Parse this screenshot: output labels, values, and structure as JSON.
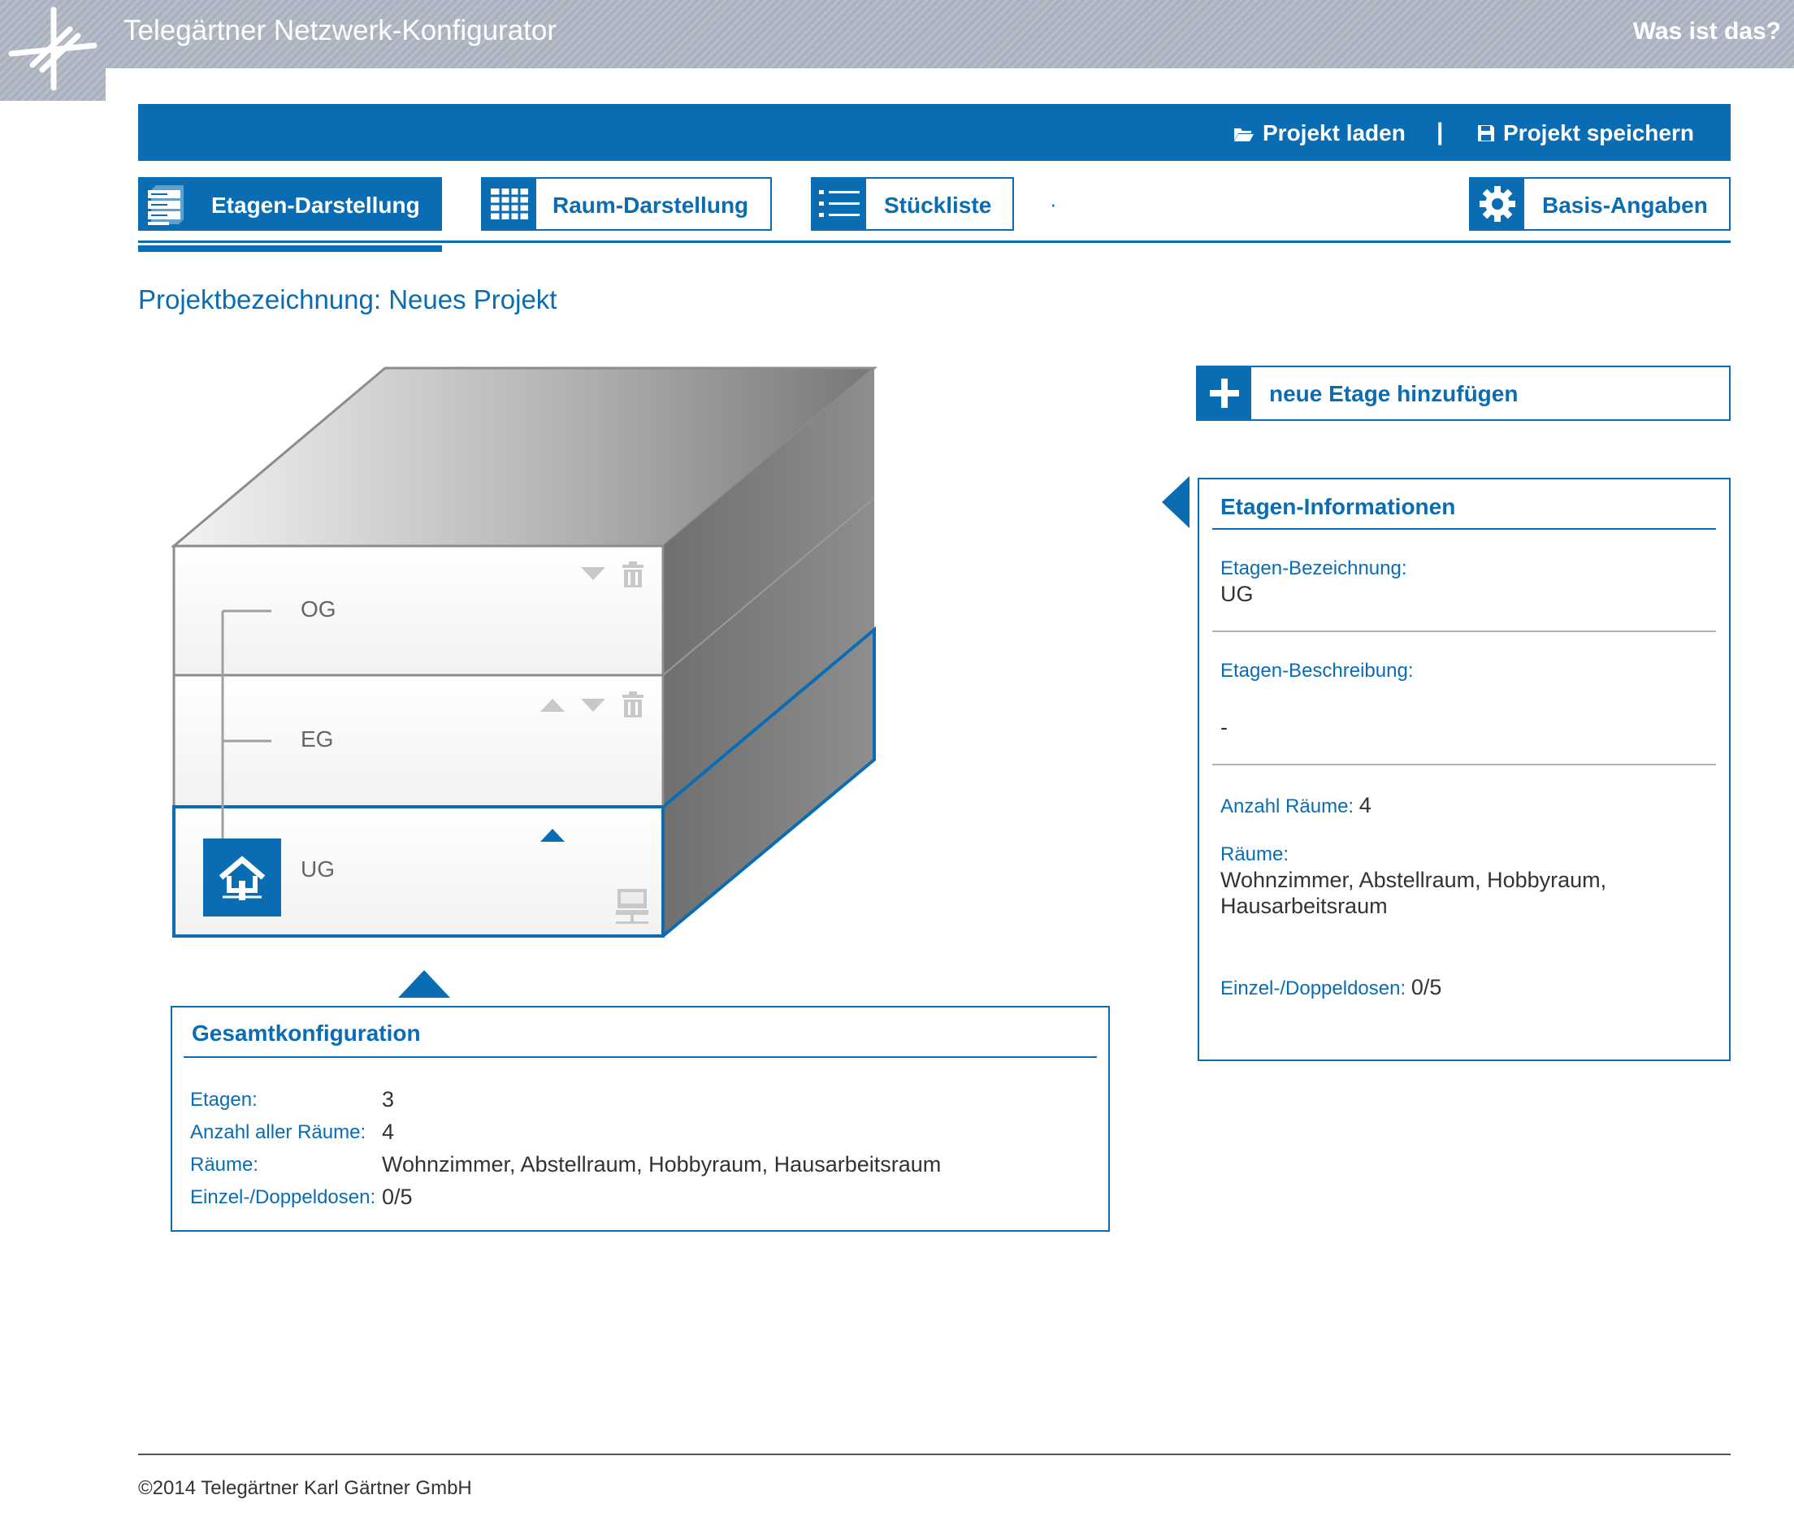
{
  "header": {
    "title": "Telegärtner Netzwerk-Konfigurator",
    "help_link": "Was ist das?",
    "logo_icon": "telegaertner-logo-icon"
  },
  "toolbar": {
    "load_label": "Projekt laden",
    "separator": "|",
    "save_label": "Projekt speichern"
  },
  "tabs": [
    {
      "label": "Etagen-Darstellung",
      "icon": "floors-icon",
      "active": true
    },
    {
      "label": "Raum-Darstellung",
      "icon": "grid-icon",
      "active": false
    },
    {
      "label": "Stückliste",
      "icon": "list-icon",
      "active": false
    },
    {
      "label": "Basis-Angaben",
      "icon": "gear-icon",
      "active": false
    }
  ],
  "tab_dot": "·",
  "project": {
    "label": "Projektbezeichnung:",
    "name": "Neues Projekt"
  },
  "floors": [
    {
      "name": "OG",
      "controls": [
        "down",
        "delete"
      ]
    },
    {
      "name": "EG",
      "controls": [
        "up",
        "down",
        "delete"
      ]
    },
    {
      "name": "UG",
      "controls": [
        "up"
      ],
      "selected": true,
      "has_home": true
    }
  ],
  "add_floor": {
    "label": "neue Etage hinzufügen"
  },
  "floor_info": {
    "title": "Etagen-Informationen",
    "name_label": "Etagen-Bezeichnung:",
    "name_value": "UG",
    "desc_label": "Etagen-Beschreibung:",
    "desc_value": "-",
    "rooms_count_label": "Anzahl Räume:",
    "rooms_count_value": "4",
    "rooms_label": "Räume:",
    "rooms_value_line1": "Wohnzimmer, Abstellraum, Hobbyraum,",
    "rooms_value_line2": "Hausarbeitsraum",
    "sockets_label": "Einzel-/Doppeldosen:",
    "sockets_value": "0/5"
  },
  "summary": {
    "title": "Gesamtkonfiguration",
    "floors_label": "Etagen:",
    "floors_value": "3",
    "rooms_count_label": "Anzahl aller Räume:",
    "rooms_count_value": "4",
    "rooms_label": "Räume:",
    "rooms_value": "Wohnzimmer, Abstellraum, Hobbyraum, Hausarbeitsraum",
    "sockets_label": "Einzel-/Doppeldosen:",
    "sockets_value": "0/5"
  },
  "footer": {
    "copyright": "©2014 Telegärtner Karl Gärtner GmbH"
  },
  "colors": {
    "brand_blue": "#0a6db3",
    "header_grey": "#a9b1bf",
    "floor_grey": "#8c8c8c"
  }
}
